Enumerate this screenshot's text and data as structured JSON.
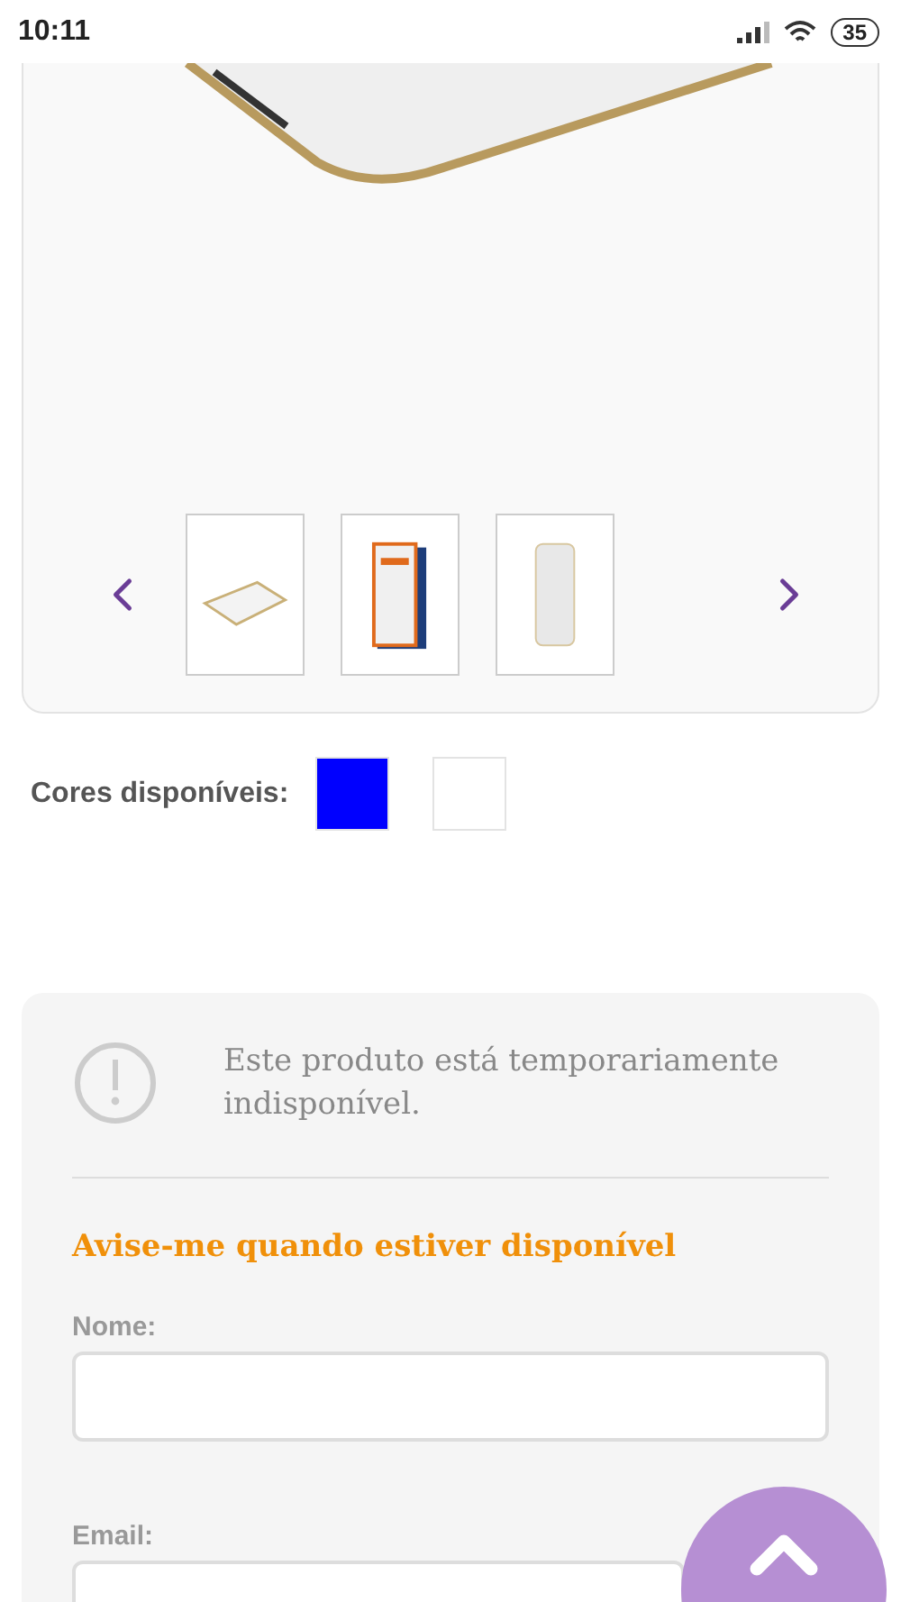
{
  "status_bar": {
    "time": "10:11",
    "battery": "35"
  },
  "colors": {
    "label": "Cores disponíveis:",
    "options": [
      {
        "color": "#0000ff"
      },
      {
        "color": "#ffffff"
      }
    ]
  },
  "notice": {
    "message": "Este produto está temporariamente indisponível.",
    "heading": "Avise-me quando estiver disponível",
    "fields": [
      {
        "label": "Nome:"
      },
      {
        "label": "Email:"
      }
    ]
  }
}
